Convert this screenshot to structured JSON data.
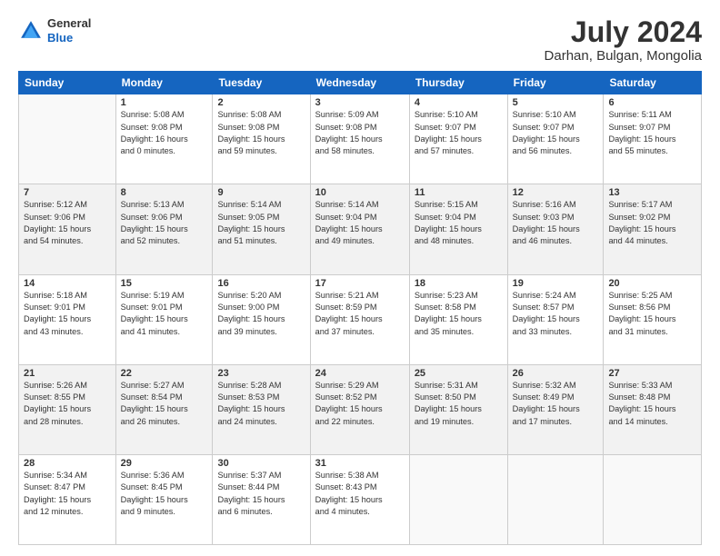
{
  "header": {
    "logo": {
      "line1": "General",
      "line2": "Blue"
    },
    "title": "July 2024",
    "location": "Darhan, Bulgan, Mongolia"
  },
  "weekdays": [
    "Sunday",
    "Monday",
    "Tuesday",
    "Wednesday",
    "Thursday",
    "Friday",
    "Saturday"
  ],
  "weeks": [
    [
      {
        "day": "",
        "info": ""
      },
      {
        "day": "1",
        "info": "Sunrise: 5:08 AM\nSunset: 9:08 PM\nDaylight: 16 hours\nand 0 minutes."
      },
      {
        "day": "2",
        "info": "Sunrise: 5:08 AM\nSunset: 9:08 PM\nDaylight: 15 hours\nand 59 minutes."
      },
      {
        "day": "3",
        "info": "Sunrise: 5:09 AM\nSunset: 9:08 PM\nDaylight: 15 hours\nand 58 minutes."
      },
      {
        "day": "4",
        "info": "Sunrise: 5:10 AM\nSunset: 9:07 PM\nDaylight: 15 hours\nand 57 minutes."
      },
      {
        "day": "5",
        "info": "Sunrise: 5:10 AM\nSunset: 9:07 PM\nDaylight: 15 hours\nand 56 minutes."
      },
      {
        "day": "6",
        "info": "Sunrise: 5:11 AM\nSunset: 9:07 PM\nDaylight: 15 hours\nand 55 minutes."
      }
    ],
    [
      {
        "day": "7",
        "info": "Sunrise: 5:12 AM\nSunset: 9:06 PM\nDaylight: 15 hours\nand 54 minutes."
      },
      {
        "day": "8",
        "info": "Sunrise: 5:13 AM\nSunset: 9:06 PM\nDaylight: 15 hours\nand 52 minutes."
      },
      {
        "day": "9",
        "info": "Sunrise: 5:14 AM\nSunset: 9:05 PM\nDaylight: 15 hours\nand 51 minutes."
      },
      {
        "day": "10",
        "info": "Sunrise: 5:14 AM\nSunset: 9:04 PM\nDaylight: 15 hours\nand 49 minutes."
      },
      {
        "day": "11",
        "info": "Sunrise: 5:15 AM\nSunset: 9:04 PM\nDaylight: 15 hours\nand 48 minutes."
      },
      {
        "day": "12",
        "info": "Sunrise: 5:16 AM\nSunset: 9:03 PM\nDaylight: 15 hours\nand 46 minutes."
      },
      {
        "day": "13",
        "info": "Sunrise: 5:17 AM\nSunset: 9:02 PM\nDaylight: 15 hours\nand 44 minutes."
      }
    ],
    [
      {
        "day": "14",
        "info": "Sunrise: 5:18 AM\nSunset: 9:01 PM\nDaylight: 15 hours\nand 43 minutes."
      },
      {
        "day": "15",
        "info": "Sunrise: 5:19 AM\nSunset: 9:01 PM\nDaylight: 15 hours\nand 41 minutes."
      },
      {
        "day": "16",
        "info": "Sunrise: 5:20 AM\nSunset: 9:00 PM\nDaylight: 15 hours\nand 39 minutes."
      },
      {
        "day": "17",
        "info": "Sunrise: 5:21 AM\nSunset: 8:59 PM\nDaylight: 15 hours\nand 37 minutes."
      },
      {
        "day": "18",
        "info": "Sunrise: 5:23 AM\nSunset: 8:58 PM\nDaylight: 15 hours\nand 35 minutes."
      },
      {
        "day": "19",
        "info": "Sunrise: 5:24 AM\nSunset: 8:57 PM\nDaylight: 15 hours\nand 33 minutes."
      },
      {
        "day": "20",
        "info": "Sunrise: 5:25 AM\nSunset: 8:56 PM\nDaylight: 15 hours\nand 31 minutes."
      }
    ],
    [
      {
        "day": "21",
        "info": "Sunrise: 5:26 AM\nSunset: 8:55 PM\nDaylight: 15 hours\nand 28 minutes."
      },
      {
        "day": "22",
        "info": "Sunrise: 5:27 AM\nSunset: 8:54 PM\nDaylight: 15 hours\nand 26 minutes."
      },
      {
        "day": "23",
        "info": "Sunrise: 5:28 AM\nSunset: 8:53 PM\nDaylight: 15 hours\nand 24 minutes."
      },
      {
        "day": "24",
        "info": "Sunrise: 5:29 AM\nSunset: 8:52 PM\nDaylight: 15 hours\nand 22 minutes."
      },
      {
        "day": "25",
        "info": "Sunrise: 5:31 AM\nSunset: 8:50 PM\nDaylight: 15 hours\nand 19 minutes."
      },
      {
        "day": "26",
        "info": "Sunrise: 5:32 AM\nSunset: 8:49 PM\nDaylight: 15 hours\nand 17 minutes."
      },
      {
        "day": "27",
        "info": "Sunrise: 5:33 AM\nSunset: 8:48 PM\nDaylight: 15 hours\nand 14 minutes."
      }
    ],
    [
      {
        "day": "28",
        "info": "Sunrise: 5:34 AM\nSunset: 8:47 PM\nDaylight: 15 hours\nand 12 minutes."
      },
      {
        "day": "29",
        "info": "Sunrise: 5:36 AM\nSunset: 8:45 PM\nDaylight: 15 hours\nand 9 minutes."
      },
      {
        "day": "30",
        "info": "Sunrise: 5:37 AM\nSunset: 8:44 PM\nDaylight: 15 hours\nand 6 minutes."
      },
      {
        "day": "31",
        "info": "Sunrise: 5:38 AM\nSunset: 8:43 PM\nDaylight: 15 hours\nand 4 minutes."
      },
      {
        "day": "",
        "info": ""
      },
      {
        "day": "",
        "info": ""
      },
      {
        "day": "",
        "info": ""
      }
    ]
  ]
}
